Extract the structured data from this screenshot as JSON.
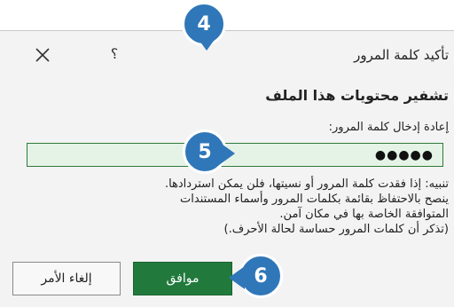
{
  "dialog": {
    "title": "تأكيد كلمة المرور",
    "help_symbol": "؟",
    "heading": "تشفير محتويات هذا الملف",
    "field_label_accel": "إ",
    "field_label_rest": "عادة إدخال كلمة المرور:",
    "password_mask": "●●●●●",
    "warning_lines": [
      "تنبيه: إذا فقدت كلمة المرور أو نسيتها، فلن يمكن استردادها.",
      "ينصح بالاحتفاظ بقائمة بكلمات المرور وأسماء المستندات",
      "المتوافقة الخاصة بها في مكان آمن.",
      "(تذكر أن كلمات المرور حساسة لحالة الأحرف.)"
    ],
    "ok_label": "موافق",
    "cancel_label": "إلغاء الأمر"
  },
  "callouts": {
    "step4": "4",
    "step5": "5",
    "step6": "6"
  },
  "colors": {
    "accent": "#217a3c",
    "field_bg": "#e4f3e6",
    "callout": "#2f77b9"
  }
}
